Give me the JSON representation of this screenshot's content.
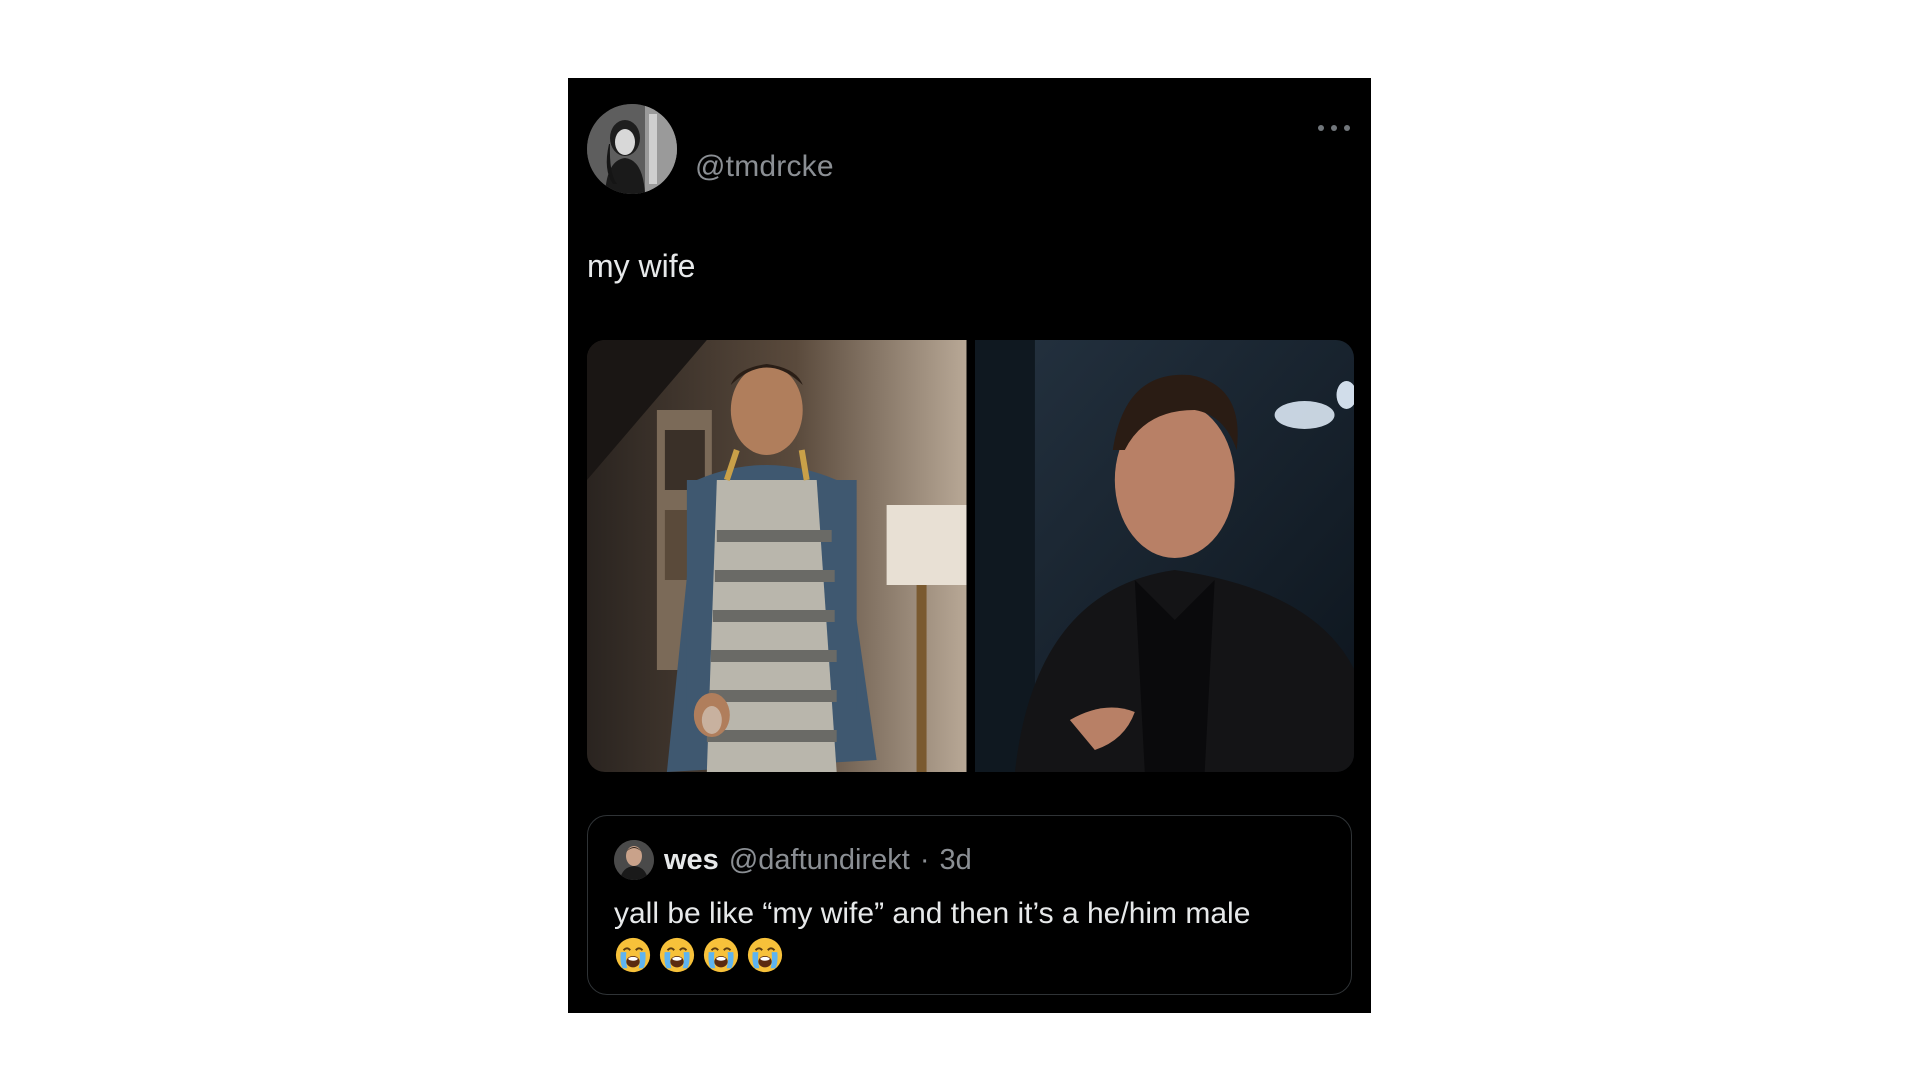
{
  "tweet": {
    "handle": "@tmdrcke",
    "text": "my wife",
    "media": [
      {
        "description_icon": "photo-man-apron"
      },
      {
        "description_icon": "photo-man-jacket"
      }
    ]
  },
  "quote": {
    "name": "wes",
    "handle": "@daftundirekt",
    "separator": "·",
    "time": "3d",
    "text": "yall be like “my wife” and then it’s a he/him male",
    "emoji_icon": "loudly-crying-face-icon",
    "emoji_count": 4
  },
  "colors": {
    "background": "#000000",
    "text": "#e7e9ea",
    "secondary": "#8b8f94",
    "border": "#2f3336"
  }
}
